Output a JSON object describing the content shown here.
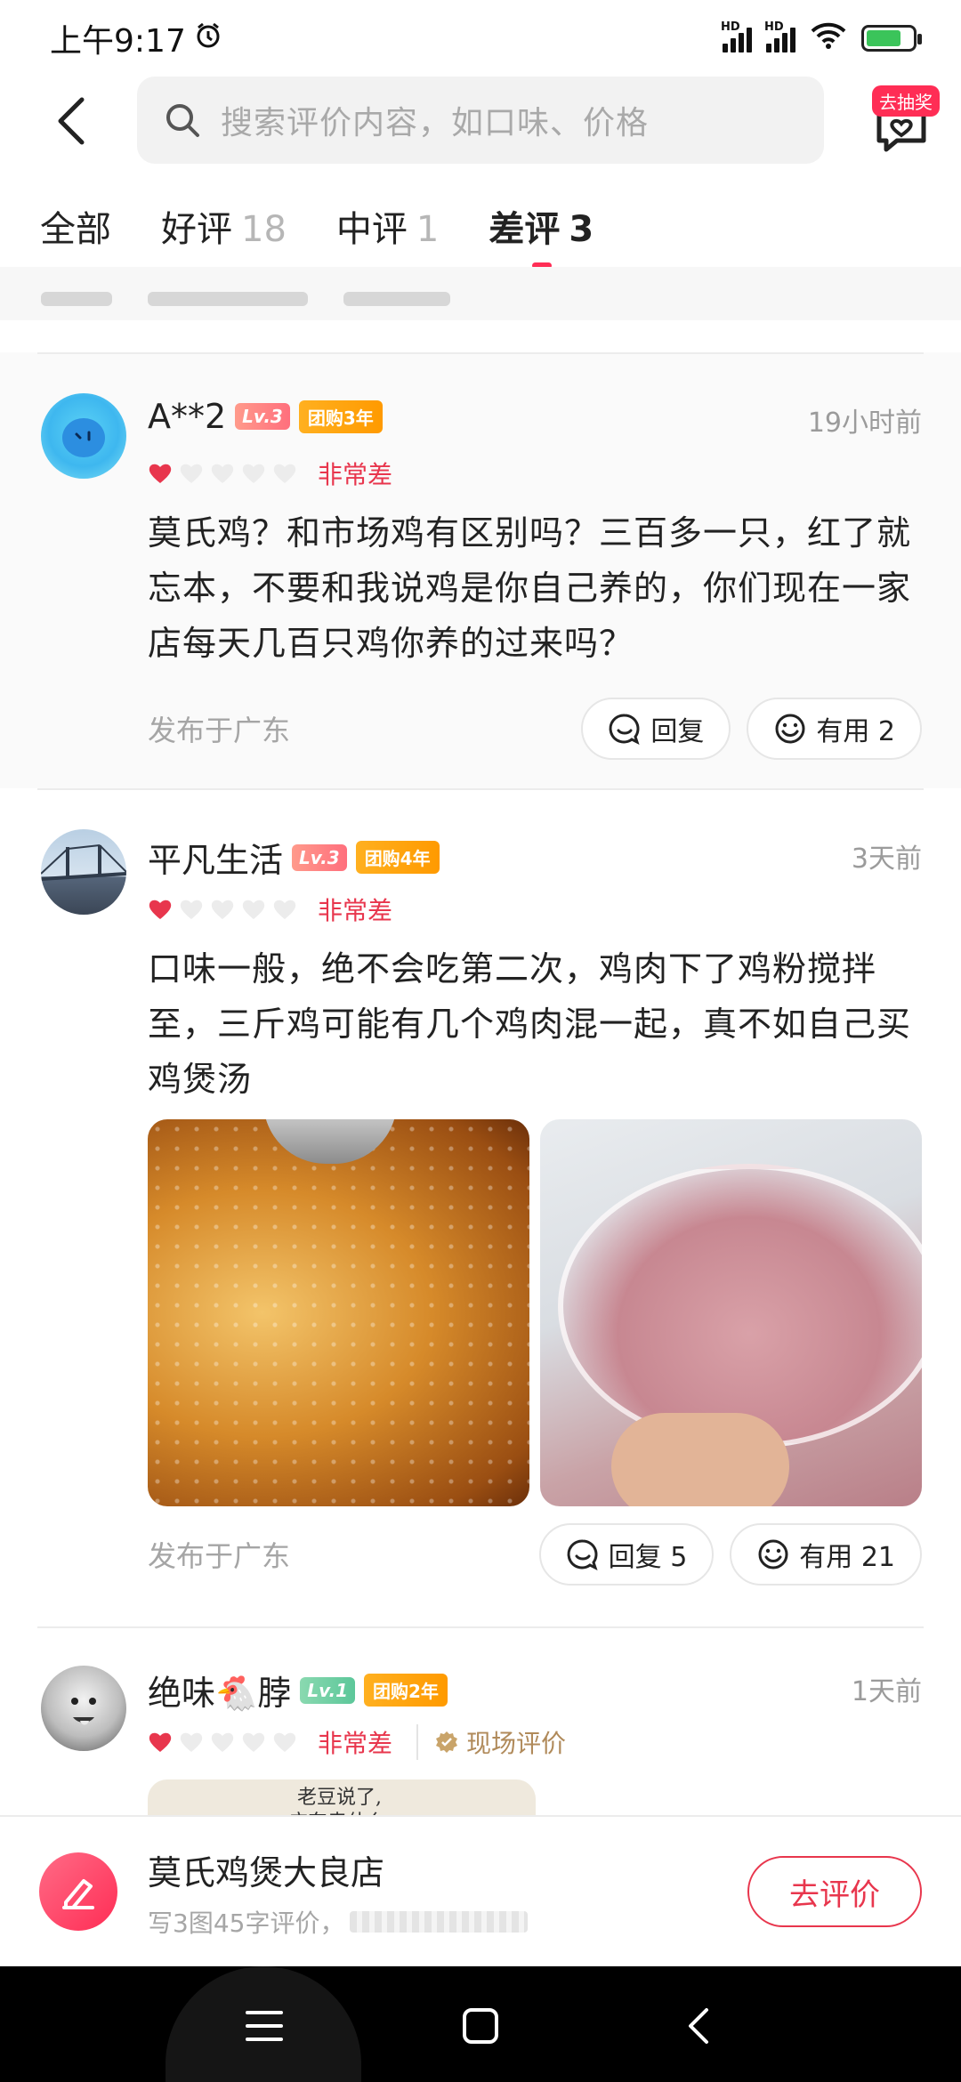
{
  "status_bar": {
    "time": "上午9:17",
    "network": "HD",
    "battery_level": 0.76
  },
  "header": {
    "search_placeholder": "搜索评价内容，如口味、价格",
    "lottery_label": "去抽奖"
  },
  "tabs": [
    {
      "label": "全部",
      "count": ""
    },
    {
      "label": "好评",
      "count": "18"
    },
    {
      "label": "中评",
      "count": "1"
    },
    {
      "label": "差评",
      "count": "3"
    }
  ],
  "active_tab": "差评",
  "reviews": [
    {
      "user": "A**2",
      "level": "Lv.3",
      "tuan": "团购3年",
      "time": "19小时前",
      "rating": 1,
      "rating_text": "非常差",
      "content": "莫氏鸡？和市场鸡有区别吗？三百多一只，红了就忘本，不要和我说鸡是你自己养的，你们现在一家店每天几百只鸡你养的过来吗？",
      "location": "发布于广东",
      "reply_label": "回复",
      "useful_label": "有用 2"
    },
    {
      "user": "平凡生活",
      "level": "Lv.3",
      "tuan": "团购4年",
      "time": "3天前",
      "rating": 1,
      "rating_text": "非常差",
      "content": "口味一般，绝不会吃第二次，鸡肉下了鸡粉搅拌至，三斤鸡可能有几个鸡肉混一起，真不如自己买鸡煲汤",
      "location": "发布于广东",
      "reply_label": "回复 5",
      "useful_label": "有用 21"
    },
    {
      "user": "绝味🐔脖",
      "level": "Lv.1",
      "tuan": "团购2年",
      "time": "1天前",
      "rating": 1,
      "rating_text": "非常差",
      "site_badge": "现场评价",
      "photo_text_1": "老豆说了,",
      "photo_text_2": "广东卖什么."
    }
  ],
  "bottom_bar": {
    "shop_name": "莫氏鸡煲大良店",
    "hint": "写3图45字评价，",
    "button": "去评价"
  },
  "colors": {
    "accent": "#ff2d55",
    "rating_red": "#e8364d",
    "muted": "#a5a5a5"
  }
}
